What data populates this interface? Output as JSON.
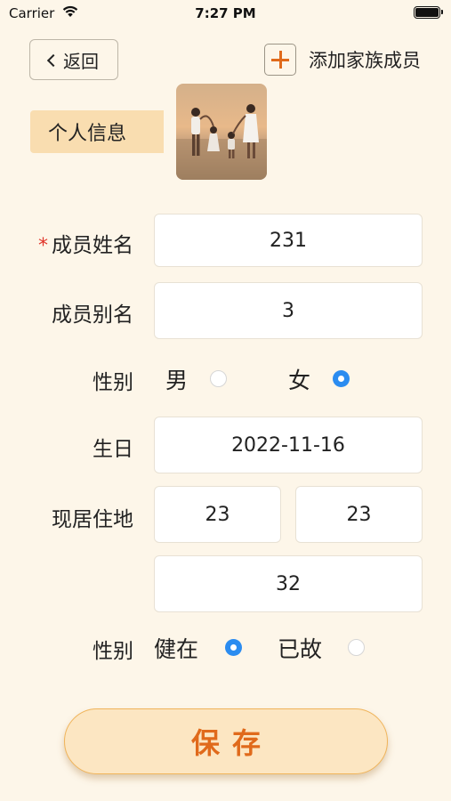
{
  "status_bar": {
    "carrier": "Carrier",
    "time": "7:27 PM"
  },
  "nav": {
    "back_label": "返回",
    "add_member_label": "添加家族成员"
  },
  "section_tag": "个人信息",
  "photo_icon": "family-photo",
  "form": {
    "name_label": "成员姓名",
    "name_value": "231",
    "alias_label": "成员别名",
    "alias_value": "3",
    "gender_label": "性别",
    "gender_options": [
      "男",
      "女"
    ],
    "gender_selected": "女",
    "birthday_label": "生日",
    "birthday_value": "2022-11-16",
    "residence_label": "现居住地",
    "residence_values": [
      "23",
      "23",
      "32"
    ],
    "status_label": "性别",
    "status_options": [
      "健在",
      "已故"
    ],
    "status_selected": "健在"
  },
  "save_label": "保存",
  "colors": {
    "background": "#FDF6E9",
    "accent": "#E06A1B",
    "tag": "#F9DDB0",
    "radio_on": "#2B8CF0",
    "required": "#E0352B"
  }
}
